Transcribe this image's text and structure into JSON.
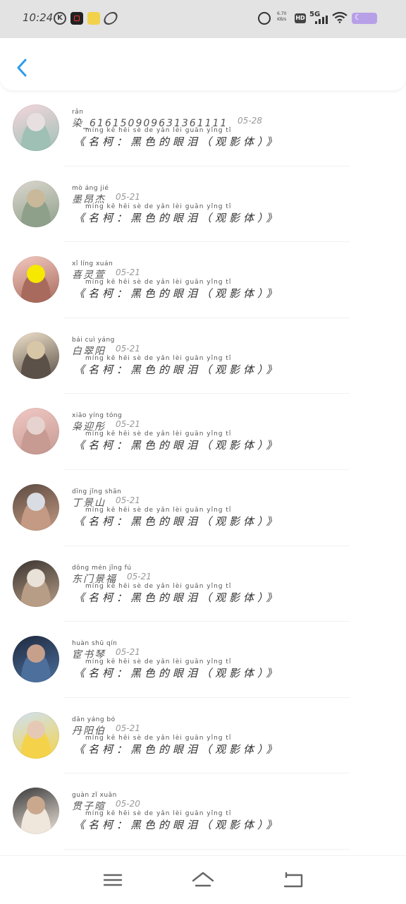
{
  "status_bar": {
    "time": "10:24",
    "network_speed_value": "6.70",
    "network_speed_unit": "KB/s",
    "hd_label": "HD",
    "signal_label": "5G"
  },
  "icons": {
    "back": "chevron-left-icon",
    "menu": "menu-icon",
    "home": "home-icon",
    "back_nav": "back-nav-icon"
  },
  "colors": {
    "accent": "#2b9bf0",
    "status_bar_bg": "#e3e3e3",
    "battery": "#b8a0e8"
  },
  "items": [
    {
      "pinyin": "rǎn",
      "username": "染_616150909631361111",
      "date": "05-28",
      "title_pinyin": "míng kē   hēi sè  de  yǎn lèi   guān yǐng tǐ",
      "title": "《名柯：黑色的眼泪（观影体）》",
      "avatar_colors": [
        "#f4d6dc",
        "#9ec0b5",
        "#e8e0e0"
      ]
    },
    {
      "pinyin": "mò áng jié",
      "username": "墨昂杰",
      "date": "05-21",
      "title_pinyin": "míng kē   hēi sè  de  yǎn lèi   guān yǐng tǐ",
      "title": "《名柯：黑色的眼泪（观影体）》",
      "avatar_colors": [
        "#dcd7cf",
        "#8ea08a",
        "#c9b89a"
      ]
    },
    {
      "pinyin": "xǐ líng xuán",
      "username": "喜灵萱",
      "date": "05-21",
      "title_pinyin": "míng kē   hēi sè  de  yǎn lèi   guān yǐng tǐ",
      "title": "《名柯：黑色的眼泪（观影体）》",
      "avatar_colors": [
        "#f3c9c0",
        "#a86a5c",
        "#f7e800"
      ]
    },
    {
      "pinyin": "bái cuì yáng",
      "username": "白翠阳",
      "date": "05-21",
      "title_pinyin": "míng kē   hēi sè  de  yǎn lèi   guān yǐng tǐ",
      "title": "《名柯：黑色的眼泪（观影体）》",
      "avatar_colors": [
        "#f1e3cc",
        "#5c5148",
        "#d8c7a6"
      ]
    },
    {
      "pinyin": "xiāo yíng tóng",
      "username": "枭迎彤",
      "date": "05-21",
      "title_pinyin": "míng kē   hēi sè  de  yǎn lèi   guān yǐng tǐ",
      "title": "《名柯：黑色的眼泪（观影体）》",
      "avatar_colors": [
        "#f0c8c4",
        "#c79a92",
        "#e6d3cf"
      ]
    },
    {
      "pinyin": "dīng jǐng shān",
      "username": "丁景山",
      "date": "05-21",
      "title_pinyin": "míng kē   hēi sè  de  yǎn lèi   guān yǐng tǐ",
      "title": "《名柯：黑色的眼泪（观影体）》",
      "avatar_colors": [
        "#5b4a40",
        "#c49a84",
        "#d9dde3"
      ]
    },
    {
      "pinyin": "dōng mén jǐng fú",
      "username": "东门景福",
      "date": "05-21",
      "title_pinyin": "míng kē   hēi sè  de  yǎn lèi   guān yǐng tǐ",
      "title": "《名柯：黑色的眼泪（观影体）》",
      "avatar_colors": [
        "#3a3430",
        "#b79d86",
        "#e9e2d8"
      ]
    },
    {
      "pinyin": "huàn shū qín",
      "username": "宦书琴",
      "date": "05-21",
      "title_pinyin": "míng kē   hēi sè  de  yǎn lèi   guān yǐng tǐ",
      "title": "《名柯：黑色的眼泪（观影体）》",
      "avatar_colors": [
        "#1f2a3f",
        "#4c6f9c",
        "#c7a08c"
      ]
    },
    {
      "pinyin": "dān yáng bó",
      "username": "丹阳伯",
      "date": "05-21",
      "title_pinyin": "míng kē   hēi sè  de  yǎn lèi   guān yǐng tǐ",
      "title": "《名柯：黑色的眼泪（观影体）》",
      "avatar_colors": [
        "#cfe1f3",
        "#f4d34a",
        "#e6c9b4"
      ]
    },
    {
      "pinyin": "guàn zǐ xuān",
      "username": "贯子暄",
      "date": "05-20",
      "title_pinyin": "míng kē   hēi sè  de  yǎn lèi   guān yǐng tǐ",
      "title": "《名柯：黑色的眼泪（观影体）》",
      "avatar_colors": [
        "#3b3a3a",
        "#efe6dc",
        "#c9a88e"
      ]
    }
  ]
}
